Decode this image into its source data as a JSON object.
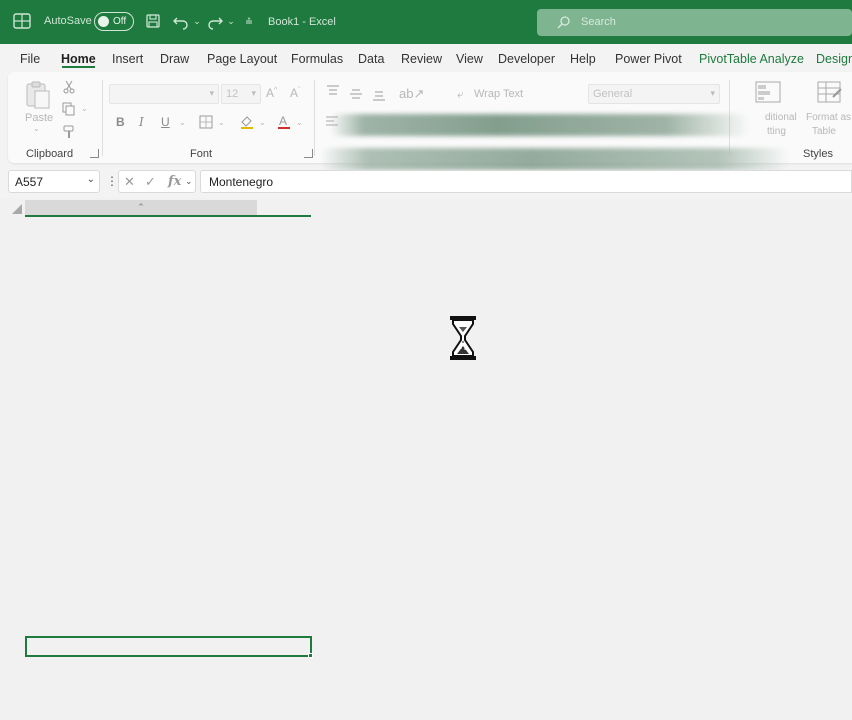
{
  "titlebar": {
    "autosave_label": "AutoSave",
    "autosave_state": "Off",
    "document_title": "Book1 - Excel",
    "search_placeholder": "Search",
    "accent": "#1e7a3e"
  },
  "tabs": [
    {
      "label": "File"
    },
    {
      "label": "Home",
      "active": true
    },
    {
      "label": "Insert"
    },
    {
      "label": "Draw"
    },
    {
      "label": "Page Layout"
    },
    {
      "label": "Formulas"
    },
    {
      "label": "Data"
    },
    {
      "label": "Review"
    },
    {
      "label": "View"
    },
    {
      "label": "Developer"
    },
    {
      "label": "Help"
    },
    {
      "label": "Power Pivot"
    },
    {
      "label": "PivotTable Analyze",
      "contextual": true
    },
    {
      "label": "Design",
      "contextual": true
    }
  ],
  "ribbon": {
    "clipboard": {
      "label": "Clipboard",
      "paste": "Paste"
    },
    "font": {
      "label": "Font",
      "font_size": "12",
      "bold": "B",
      "italic": "I",
      "underline": "U"
    },
    "alignment": {
      "wrap_text": "Wrap Text"
    },
    "number": {
      "format": "General"
    },
    "styles": {
      "label": "Styles",
      "conditional_1": "ditional",
      "conditional_2": "tting",
      "format_as_table_1": "Format as",
      "format_as_table_2": "Table"
    }
  },
  "formula_bar": {
    "name_box": "A557",
    "fx_label": "fx",
    "content": "Montenegro"
  },
  "grid": {
    "loading_icon": "hourglass-icon"
  }
}
